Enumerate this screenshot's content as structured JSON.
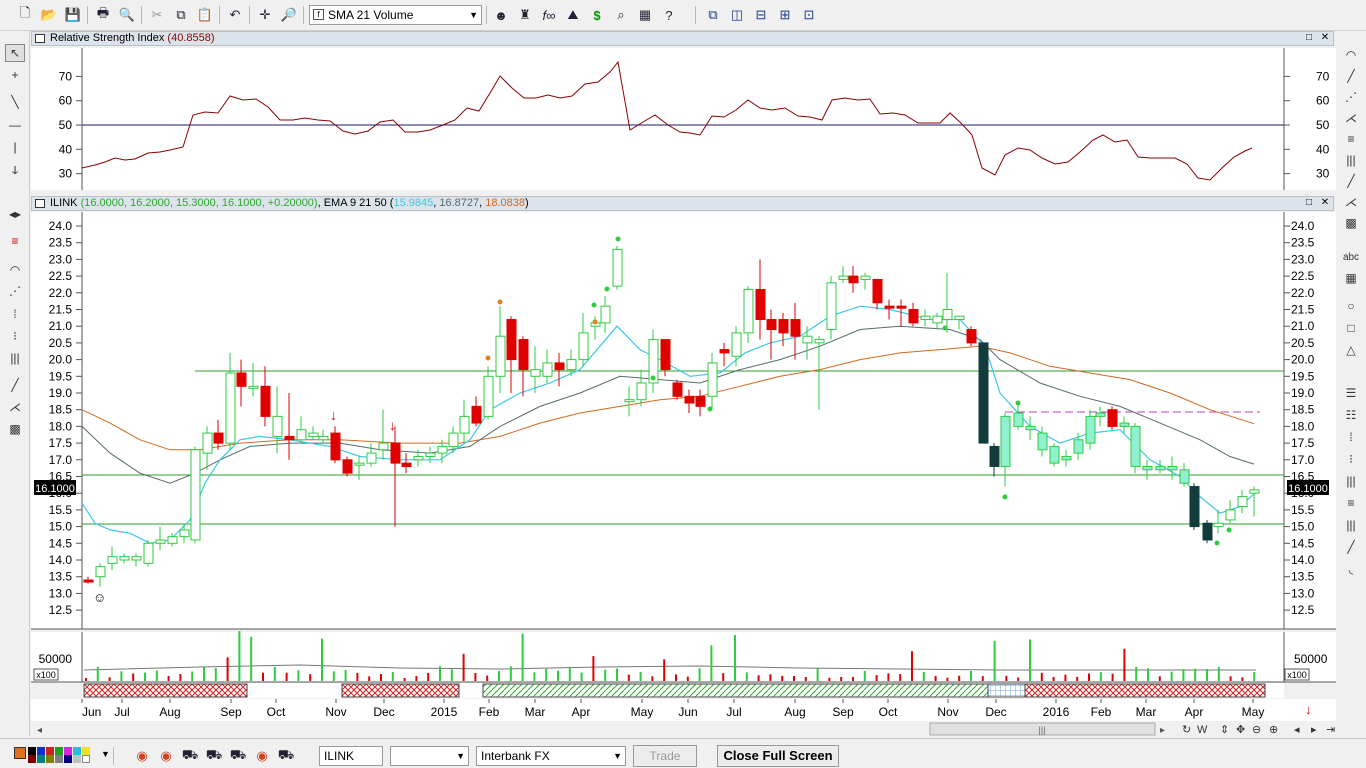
{
  "toolbar": {
    "indicator_select": "SMA 21 Volume"
  },
  "rsi_panel": {
    "title": "Relative Strength Index",
    "value": "(40.8558)",
    "ticks": [
      "70",
      "60",
      "50",
      "40",
      "30"
    ]
  },
  "price_panel": {
    "symbol": "ILINK",
    "ohlc": "(16.0000, 16.2000, 15.3000, 16.1000, +0.20000)",
    "ema_label": "EMA 9 21 50",
    "ema_open": "(",
    "ema_v1": "15.9845",
    "ema_v2": "16.8727",
    "ema_v3": "18.0838",
    "ema_close": ")",
    "ticks": [
      "24.0",
      "23.5",
      "23.0",
      "22.5",
      "22.0",
      "21.5",
      "21.0",
      "20.5",
      "20.0",
      "19.5",
      "19.0",
      "18.5",
      "18.0",
      "17.5",
      "17.0",
      "16.5",
      "16.0",
      "15.5",
      "15.0",
      "14.5",
      "14.0",
      "13.5",
      "13.0",
      "12.5"
    ],
    "last_price": "16.1000"
  },
  "volume_panel": {
    "tick": "50000",
    "multiplier": "x100"
  },
  "xaxis": {
    "labels": [
      "Jun",
      "Jul",
      "Aug",
      "Sep",
      "Oct",
      "Nov",
      "Dec",
      "2015",
      "Feb",
      "Mar",
      "Apr",
      "May",
      "Jun",
      "Jul",
      "Aug",
      "Sep",
      "Oct",
      "Nov",
      "Dec",
      "2016",
      "Feb",
      "Mar",
      "Apr",
      "May"
    ]
  },
  "nav": {
    "scroll_letters": "W"
  },
  "bottom": {
    "symbol_value": "ILINK",
    "period_value": "",
    "feed_value": "Interbank FX",
    "trade_label": "Trade",
    "fullscreen_label": "Close Full Screen"
  },
  "colors": {
    "ema_fast": "#3cc8e8",
    "ema_mid": "#556b6b",
    "ema_slow": "#d2691e",
    "up_candle": "#2ecc40",
    "down_candle": "#e00000",
    "rsi_line": "#8b0000"
  }
}
